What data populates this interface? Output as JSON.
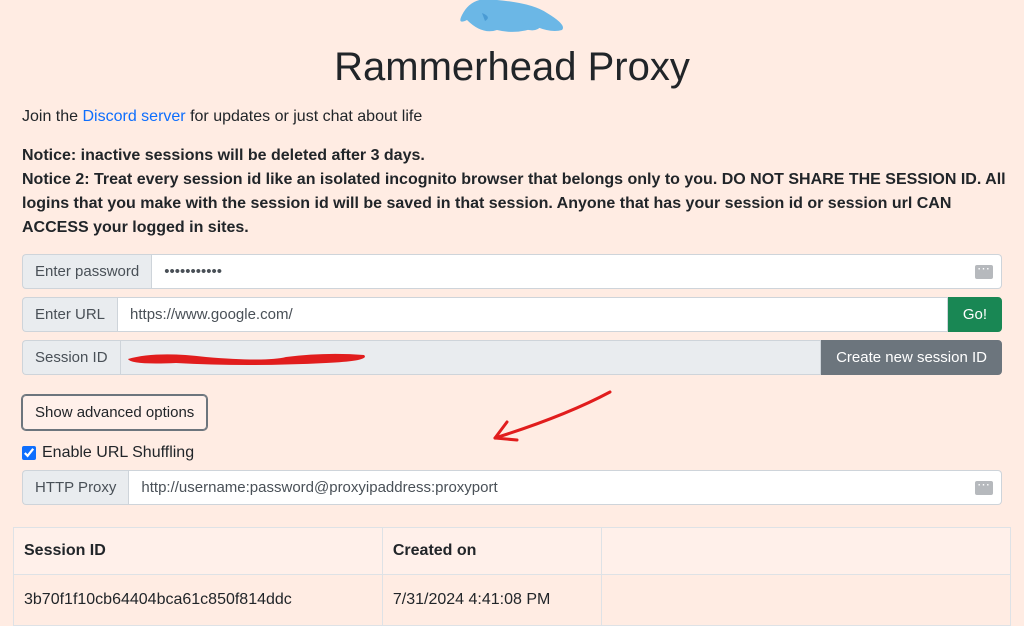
{
  "header": {
    "title": "Rammerhead Proxy",
    "join_prefix": "Join the ",
    "discord_link_text": "Discord server",
    "join_suffix": " for updates or just chat about life"
  },
  "notices": {
    "line1": "Notice: inactive sessions will be deleted after 3 days.",
    "line2": "Notice 2: Treat every session id like an isolated incognito browser that belongs only to you. DO NOT SHARE THE SESSION ID. All logins that you make with the session id will be saved in that session. Anyone that has your session id or session url CAN ACCESS your logged in sites."
  },
  "inputs": {
    "password": {
      "label": "Enter password",
      "value": "•••••••••••"
    },
    "url": {
      "label": "Enter URL",
      "value": "https://www.google.com/",
      "go_label": "Go!"
    },
    "session": {
      "label": "Session ID",
      "value": "",
      "create_label": "Create new session ID"
    },
    "http_proxy": {
      "label": "HTTP Proxy",
      "value": "http://username:password@proxyipaddress:proxyport"
    }
  },
  "advanced": {
    "toggle_label": "Show advanced options",
    "shuffle_label": "Enable URL Shuffling",
    "shuffle_checked": true
  },
  "table": {
    "head": {
      "session_id": "Session ID",
      "created_on": "Created on",
      "actions": ""
    },
    "rows": [
      {
        "session_id": "3b70f1f10cb64404bca61c850f814ddc",
        "created_on": "7/31/2024  4:41:08 PM"
      }
    ]
  },
  "colors": {
    "accent_go": "#198754",
    "accent_secondary": "#6c757d",
    "annotation": "#e11d1d"
  }
}
